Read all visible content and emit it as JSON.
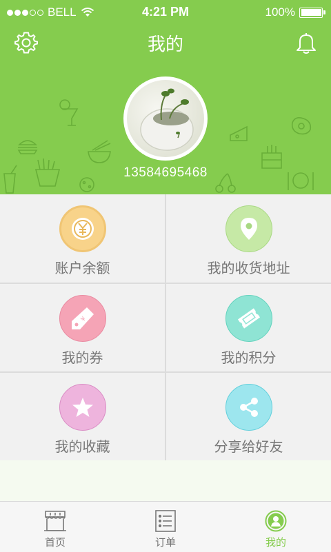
{
  "status_bar": {
    "carrier": "BELL",
    "time": "4:21 PM",
    "battery": "100%",
    "battery_level": 1.0,
    "signal_bars_filled": 3,
    "signal_bars_total": 5
  },
  "header": {
    "title": "我的",
    "phone": "13584695468",
    "background_color": "#85cc4e"
  },
  "menu": [
    {
      "label": "账户余额",
      "icon": "yen-coin-icon",
      "color": "#f8d38a"
    },
    {
      "label": "我的收货地址",
      "icon": "location-pin-icon",
      "color": "#c6e9a6"
    },
    {
      "label": "我的券",
      "icon": "coupon-tag-icon",
      "color": "#f5a4b6"
    },
    {
      "label": "我的积分",
      "icon": "ticket-icon",
      "color": "#8fe4d4"
    },
    {
      "label": "我的收藏",
      "icon": "star-icon",
      "color": "#eeb4dd"
    },
    {
      "label": "分享给好友",
      "icon": "share-icon",
      "color": "#9de6ee"
    }
  ],
  "tabbar": {
    "items": [
      {
        "label": "首页",
        "icon": "storefront-icon",
        "active": false
      },
      {
        "label": "订单",
        "icon": "order-list-icon",
        "active": false
      },
      {
        "label": "我的",
        "icon": "profile-icon",
        "active": true
      }
    ],
    "active_color": "#85cc4e"
  }
}
